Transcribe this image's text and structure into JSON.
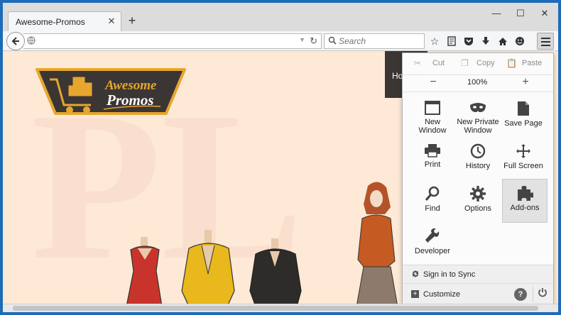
{
  "window": {
    "tab_title": "Awesome-Promos",
    "tab_close": "✕",
    "new_tab": "+",
    "minimize": "—",
    "maximize": "☐",
    "close": "✕"
  },
  "navbar": {
    "url_value": "",
    "search_placeholder": "Search",
    "toolbar_icons": [
      "bookmark-star-icon",
      "reading-list-icon",
      "pocket-icon",
      "download-icon",
      "home-icon",
      "hello-icon",
      "menu-icon"
    ]
  },
  "page": {
    "logo_line1": "Awesome",
    "logo_line2": "Promos",
    "banner_text": "Ho",
    "watermark": "PL"
  },
  "menu": {
    "cut": "Cut",
    "copy": "Copy",
    "paste": "Paste",
    "zoom_out": "−",
    "zoom_level": "100%",
    "zoom_in": "+",
    "items": [
      {
        "label1": "New Window",
        "label2": "",
        "icon": "new-window-icon"
      },
      {
        "label1": "New Private",
        "label2": "Window",
        "icon": "private-mask-icon"
      },
      {
        "label1": "Save Page",
        "label2": "",
        "icon": "save-page-icon"
      },
      {
        "label1": "Print",
        "label2": "",
        "icon": "printer-icon"
      },
      {
        "label1": "History",
        "label2": "",
        "icon": "clock-icon"
      },
      {
        "label1": "Full Screen",
        "label2": "",
        "icon": "fullscreen-icon"
      },
      {
        "label1": "Find",
        "label2": "",
        "icon": "magnifier-icon"
      },
      {
        "label1": "Options",
        "label2": "",
        "icon": "gear-icon"
      },
      {
        "label1": "Add-ons",
        "label2": "",
        "icon": "puzzle-icon"
      },
      {
        "label1": "Developer",
        "label2": "",
        "icon": "wrench-icon"
      }
    ],
    "sign_in": "Sign in to Sync",
    "customize": "Customize",
    "help": "?"
  },
  "colors": {
    "page_bg": "#fde9d6",
    "window_border": "#1e6bb8",
    "logo_dark": "#3b3634",
    "logo_gold": "#e7a62e"
  }
}
